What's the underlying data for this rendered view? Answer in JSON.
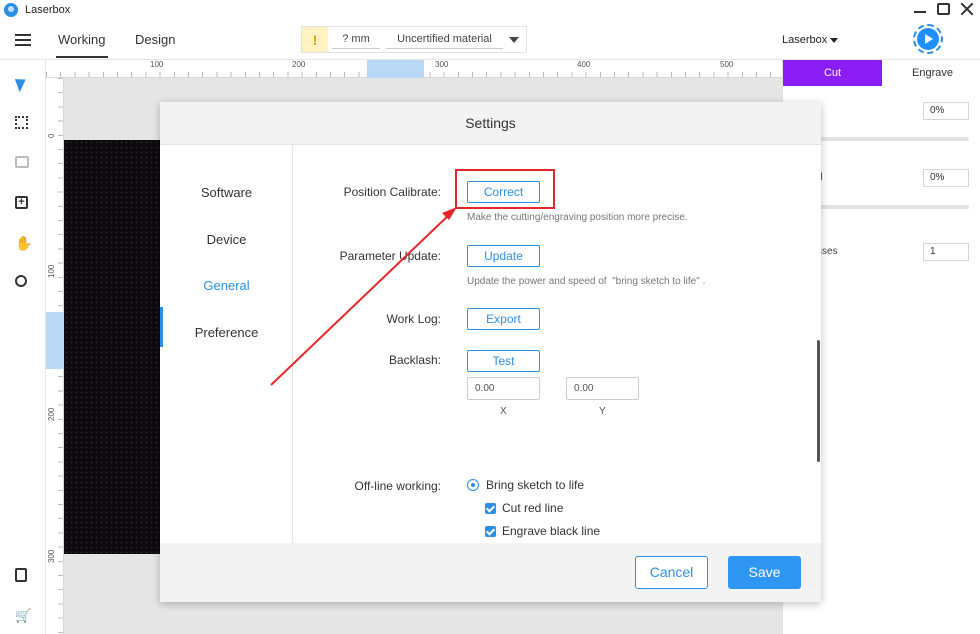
{
  "app": {
    "title": "Laserbox"
  },
  "toolbar": {
    "tabs": [
      {
        "label": "Working"
      },
      {
        "label": "Design"
      }
    ],
    "thickness": "? mm",
    "material": "Uncertified material",
    "device": "Laserbox"
  },
  "ruler": {
    "h_labels": [
      "100",
      "200",
      "300",
      "400",
      "500"
    ],
    "v_labels": [
      "0",
      "100",
      "200",
      "300"
    ]
  },
  "right_panel": {
    "tabs": [
      {
        "label": "Cut"
      },
      {
        "label": "Engrave"
      }
    ],
    "fields": [
      {
        "label": "r",
        "value": "0%"
      },
      {
        "label": "d",
        "value": "0%"
      },
      {
        "label": "sses",
        "value": "1"
      }
    ]
  },
  "settings": {
    "title": "Settings",
    "nav": [
      {
        "label": "Software"
      },
      {
        "label": "Device"
      },
      {
        "label": "General"
      },
      {
        "label": "Preference"
      }
    ],
    "active_nav": "General",
    "position_calibrate": {
      "label": "Position Calibrate:",
      "button": "Correct",
      "hint": "Make the cutting/engraving position more precise."
    },
    "parameter_update": {
      "label": "Parameter Update:",
      "button": "Update",
      "hint": "Update the power and speed of  \"bring sketch to life\" ."
    },
    "work_log": {
      "label": "Work Log:",
      "button": "Export"
    },
    "backlash": {
      "label": "Backlash:",
      "button": "Test",
      "x_value": "0.00",
      "y_value": "0.00",
      "x_label": "X",
      "y_label": "Y"
    },
    "offline": {
      "label": "Off-line working:",
      "radio": "Bring sketch to life",
      "checks": [
        "Cut red line",
        "Engrave black line"
      ]
    },
    "footer": {
      "cancel": "Cancel",
      "save": "Save"
    }
  },
  "colors": {
    "accent": "#2b8fe8",
    "cut_tab": "#8a1cf5",
    "annotation": "#e8262a"
  }
}
